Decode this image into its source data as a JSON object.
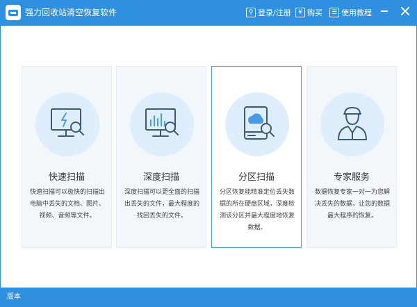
{
  "window": {
    "title": "强力回收站清空恢复软件",
    "accent": "#2f8fe0"
  },
  "toolbar": {
    "login_label": "登录/注册",
    "buy_label": "购买",
    "guide_label": "使用教程",
    "login_icon": "key-icon",
    "buy_icon": "yen-icon",
    "guide_icon": "book-icon"
  },
  "cards": [
    {
      "title": "快速扫描",
      "description": "快速扫描可以极快的扫描出电脑中丢失的文档、图片、视频、音频等文件。",
      "icon": "monitor-bolt-search-icon",
      "selected": false
    },
    {
      "title": "深度扫描",
      "description": "深度扫描可以更全面的扫描出丢失的文件，最大程度的找回丢失的文件。",
      "icon": "monitor-chart-search-icon",
      "selected": false
    },
    {
      "title": "分区扫描",
      "description": "分区恢复能精准定位丢失数据的所在硬盘区域，深度检测该分区并最大程度地恢复数据。",
      "icon": "drive-cloud-search-icon",
      "selected": true
    },
    {
      "title": "专家服务",
      "description": "数据恢复专家一对一为您解决丢失的数据，让您的数据最大程序的恢复。",
      "icon": "expert-person-icon",
      "selected": false
    }
  ],
  "status": {
    "version_label": "版本"
  }
}
